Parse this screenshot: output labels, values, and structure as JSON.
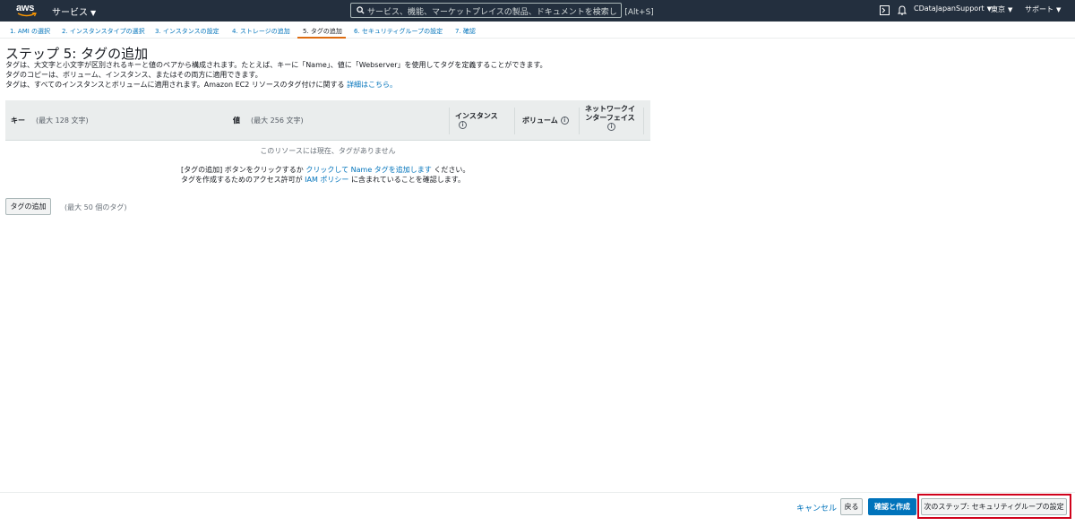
{
  "nav": {
    "logo": "aws",
    "services": "サービス",
    "search_placeholder": "サービス、機能、マーケットプレイスの製品、ドキュメントを検索し",
    "search_shortcut": "[Alt+S]",
    "account": "CDataJapanSupport",
    "region": "東京",
    "support": "サポート"
  },
  "wizard": {
    "tabs": [
      "1. AMI の選択",
      "2. インスタンスタイプの選択",
      "3. インスタンスの設定",
      "4. ストレージの追加",
      "5. タグの追加",
      "6. セキュリティグループの設定",
      "7. 確認"
    ],
    "active_index": 4
  },
  "page": {
    "title": "ステップ 5: タグの追加",
    "desc1": "タグは、大文字と小文字が区別されるキーと値のペアから構成されます。たとえば、キーに「Name」、値に「Webserver」を使用してタグを定義することができます。",
    "desc2": "タグのコピーは、ボリューム、インスタンス、またはその両方に適用できます。",
    "desc3": "タグは、すべてのインスタンスとボリュームに適用されます。Amazon EC2 リソースのタグ付けに関する",
    "desc3_link": "詳細はこちら。"
  },
  "table": {
    "key_label": "キー",
    "key_hint": "(最大 128 文字)",
    "value_label": "値",
    "value_hint": "(最大 256 文字)",
    "instances_label": "インスタンス",
    "volumes_label": "ボリューム",
    "eni_label_1": "ネットワークイ",
    "eni_label_2": "ンターフェイス",
    "empty_text": "このリソースには現在、タグがありません"
  },
  "help": {
    "line1_a": "[タグの追加] ボタンをクリックするか",
    "line1_link": "クリックして Name タグを追加します",
    "line1_b": "ください。",
    "line2_a": "タグを作成するためのアクセス許可が",
    "line2_link": "IAM ポリシー",
    "line2_b": "に含まれていることを確認します。"
  },
  "actions": {
    "add_tag": "タグの追加",
    "max_tags": "(最大 50 個のタグ)",
    "cancel": "キャンセル",
    "back": "戻る",
    "review": "確認と作成",
    "next": "次のステップ: セキュリティグループの設定"
  },
  "colors": {
    "nav_bg": "#232f3e",
    "link": "#0073bb",
    "active_tab_underline": "#dd6b10",
    "primary_button": "#0073bb",
    "highlight_box": "#d0021b"
  }
}
